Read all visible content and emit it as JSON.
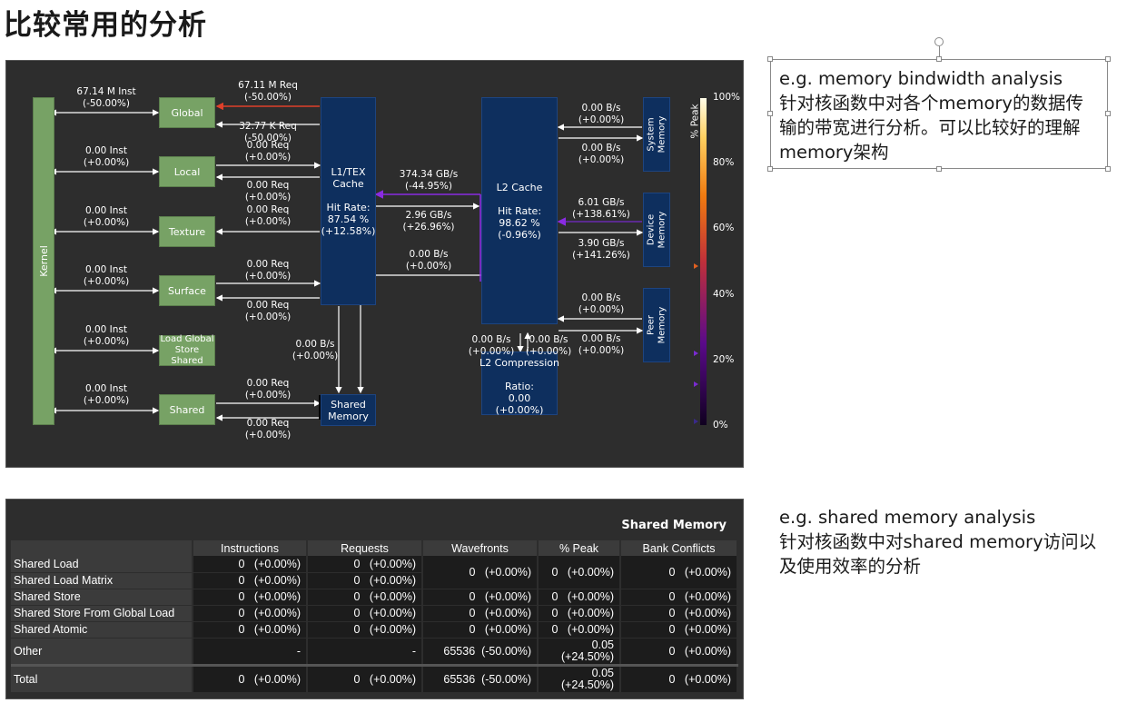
{
  "slide": {
    "title": "比较常用的分析",
    "note1": "e.g. memory bindwidth analysis\n针对核函数中对各个memory的数据传输的带宽进行分析。可以比较好的理解memory架构",
    "note2": "e.g. shared memory analysis\n针对核函数中对shared memory访问以及使用效率的分析"
  },
  "chart": {
    "kernel": "Kernel",
    "units": {
      "global": "Global",
      "local": "Local",
      "texture": "Texture",
      "surface": "Surface",
      "ldgsts": "Load Global\nStore\nShared",
      "shared": "Shared"
    },
    "l1": "L1/TEX\nCache\n\nHit Rate:\n87.54 %\n(+12.58%)",
    "sharedmem": "Shared\nMemory",
    "l2": "L2 Cache\n\nHit Rate:\n98.62 %\n(-0.96%)",
    "l2comp": "L2 Compression\n\nRatio:\n0.00\n(+0.00%)",
    "sysmem": "System\nMemory",
    "devmem": "Device\nMemory",
    "peermem": "Peer\nMemory",
    "inst": {
      "global": "67.14 M Inst\n(-50.00%)",
      "local": "0.00 Inst\n(+0.00%)",
      "texture": "0.00 Inst\n(+0.00%)",
      "surface": "0.00 Inst\n(+0.00%)",
      "ldgsts": "0.00 Inst\n(+0.00%)",
      "shared": "0.00 Inst\n(+0.00%)"
    },
    "req": {
      "global_ld": "67.11 M Req\n(-50.00%)",
      "global_st": "32.77 K Req\n(-50.00%)",
      "local_ld": "0.00 Req\n(+0.00%)",
      "local_st": "0.00 Req\n(+0.00%)",
      "texture": "0.00 Req\n(+0.00%)",
      "surface_ld": "0.00 Req\n(+0.00%)",
      "surface_st": "0.00 Req\n(+0.00%)",
      "shared_ld": "0.00 Req\n(+0.00%)",
      "shared_st": "0.00 Req\n(+0.00%)"
    },
    "bw": {
      "l1_l2_ld": "374.34 GB/s\n(-44.95%)",
      "l1_l2_st": "2.96 GB/s\n(+26.96%)",
      "l1_l2_atom": "0.00 B/s\n(+0.00%)",
      "l1_shared": "0.00 B/s\n(+0.00%)",
      "sys_ld": "0.00 B/s\n(+0.00%)",
      "sys_st": "0.00 B/s\n(+0.00%)",
      "dev_ld": "6.01 GB/s\n(+138.61%)",
      "dev_st": "3.90 GB/s\n(+141.26%)",
      "peer_ld": "0.00 B/s\n(+0.00%)",
      "peer_st": "0.00 B/s\n(+0.00%)",
      "comp_in": "0.00 B/s\n(+0.00%)",
      "comp_out": "0.00 B/s\n(+0.00%)"
    },
    "scale": {
      "title": "% Peak",
      "ticks": [
        "100%",
        "80%",
        "60%",
        "40%",
        "20%",
        "0%"
      ]
    }
  },
  "table": {
    "title": "Shared Memory",
    "headers": [
      "",
      "Instructions",
      "Requests",
      "Wavefronts",
      "% Peak",
      "Bank Conflicts"
    ],
    "rows": [
      [
        "Shared Load",
        "0   (+0.00%)",
        "0   (+0.00%)",
        "0   (+0.00%)",
        "0   (+0.00%)",
        "0   (+0.00%)"
      ],
      [
        "Shared Load Matrix",
        "0   (+0.00%)",
        "0   (+0.00%)",
        "",
        "",
        ""
      ],
      [
        "Shared Store",
        "0   (+0.00%)",
        "0   (+0.00%)",
        "0   (+0.00%)",
        "0   (+0.00%)",
        "0   (+0.00%)"
      ],
      [
        "Shared Store From Global Load",
        "0   (+0.00%)",
        "0   (+0.00%)",
        "0   (+0.00%)",
        "0   (+0.00%)",
        "0   (+0.00%)"
      ],
      [
        "Shared Atomic",
        "0   (+0.00%)",
        "0   (+0.00%)",
        "0   (+0.00%)",
        "0   (+0.00%)",
        "0   (+0.00%)"
      ],
      [
        "Other",
        "-",
        "-",
        "65536  (-50.00%)",
        "0.05\n(+24.50%)",
        "0   (+0.00%)"
      ],
      [
        "Total",
        "0   (+0.00%)",
        "0   (+0.00%)",
        "65536  (-50.00%)",
        "0.05\n(+24.50%)",
        "0   (+0.00%)"
      ]
    ]
  }
}
